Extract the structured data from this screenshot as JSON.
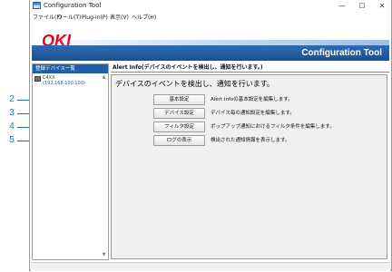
{
  "window": {
    "title": "Configuration Tool",
    "controls": {
      "minimize": "—",
      "maximize": "☐",
      "close": "✕"
    }
  },
  "menu": [
    "ファイル(F)",
    "ツール(T)",
    "Plug-in(P)",
    "表示(V)",
    "ヘルプ(H)"
  ],
  "banner": {
    "logo": "OKI",
    "title": "Configuration Tool",
    "logo_color": "#e60012",
    "bar_color": "#1d5fa8"
  },
  "sidebar": {
    "header": "登録デバイス一覧",
    "device": {
      "name": "C4XX",
      "ip": "(192.168.100.100)"
    }
  },
  "content": {
    "header": "Alert Info(デバイスのイベントを検出し、通知を行います。)",
    "heading": "デバイスのイベントを検出し、通知を行います。",
    "rows": [
      {
        "button": "基本設定",
        "description": "Alert Infoの基本設定を編集します。",
        "callout": "2"
      },
      {
        "button": "デバイス設定",
        "description": "デバイス毎の通知設定を編集します。",
        "callout": "3"
      },
      {
        "button": "フィルタ設定",
        "description": "ポップアップ通知におけるフィルタ条件を編集します。",
        "callout": "4"
      },
      {
        "button": "ログの表示",
        "description": "検出された通知情報を表示します。",
        "callout": "5"
      }
    ]
  },
  "colors": {
    "callout": "#1d6fc4"
  }
}
